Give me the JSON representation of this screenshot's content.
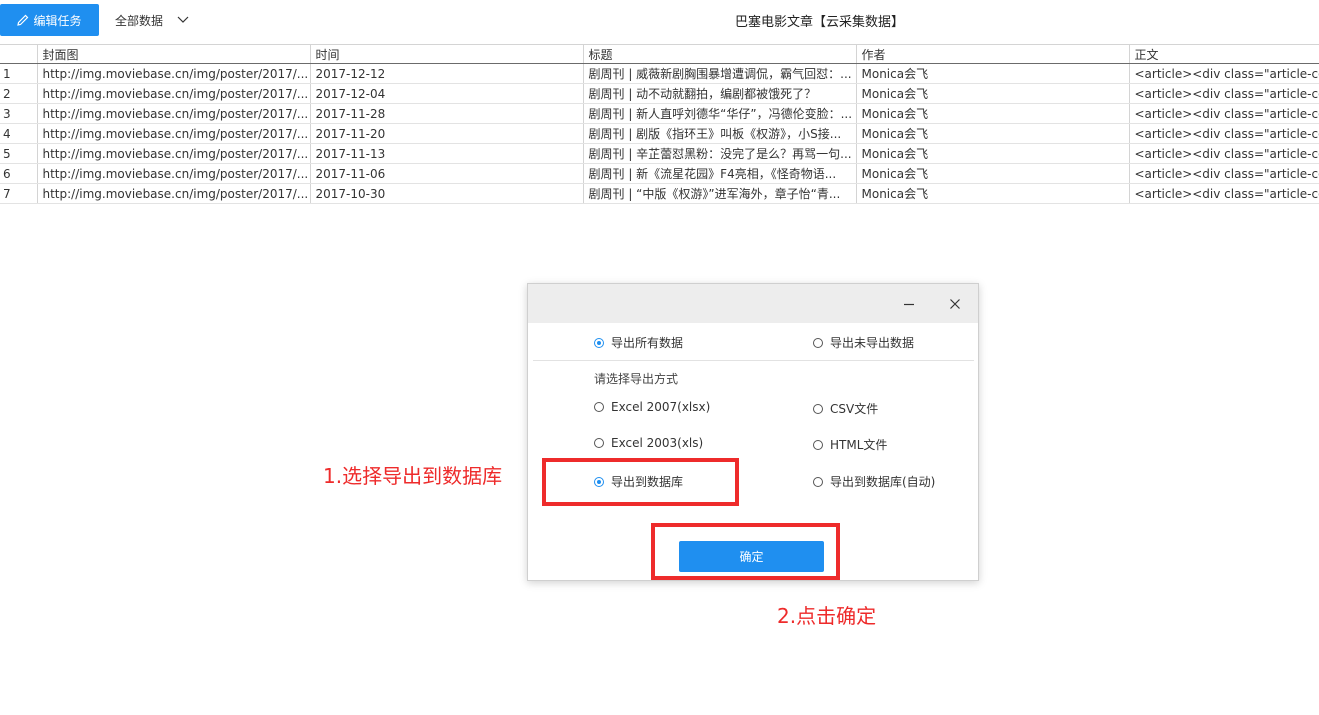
{
  "toolbar": {
    "edit_label": "编辑任务",
    "data_select_label": "全部数据",
    "title": "巴塞电影文章【云采集数据】"
  },
  "table": {
    "columns": [
      "",
      "封面图",
      "时间",
      "标题",
      "作者",
      "正文"
    ],
    "rows": [
      [
        "1",
        "http://img.moviebase.cn/img/poster/2017/...",
        "2017-12-12",
        "剧周刊 | 威薇新剧胸围暴增遭调侃，霸气回怼：...",
        "Monica会飞",
        "<article><div class=\"article-con"
      ],
      [
        "2",
        "http://img.moviebase.cn/img/poster/2017/...",
        "2017-12-04",
        "剧周刊 | 动不动就翻拍，编剧都被饿死了？",
        "Monica会飞",
        "<article><div class=\"article-con"
      ],
      [
        "3",
        "http://img.moviebase.cn/img/poster/2017/...",
        "2017-11-28",
        "剧周刊 | 新人直呼刘德华“华仔”，冯德伦变脸：...",
        "Monica会飞",
        "<article><div class=\"article-con"
      ],
      [
        "4",
        "http://img.moviebase.cn/img/poster/2017/...",
        "2017-11-20",
        "剧周刊 | 剧版《指环王》叫板《权游》，小S接...",
        "Monica会飞",
        "<article><div class=\"article-con"
      ],
      [
        "5",
        "http://img.moviebase.cn/img/poster/2017/...",
        "2017-11-13",
        "剧周刊 | 辛芷蕾怼黑粉：没完了是么？再骂一句...",
        "Monica会飞",
        "<article><div class=\"article-con"
      ],
      [
        "6",
        "http://img.moviebase.cn/img/poster/2017/...",
        "2017-11-06",
        "剧周刊 | 新《流星花园》F4亮相，《怪奇物语...",
        "Monica会飞",
        "<article><div class=\"article-con"
      ],
      [
        "7",
        "http://img.moviebase.cn/img/poster/2017/...",
        "2017-10-30",
        "剧周刊 | “中版《权游》”进军海外，章子怡“青...",
        "Monica会飞",
        "<article><div class=\"article-con"
      ]
    ]
  },
  "dialog": {
    "scope": {
      "all_label": "导出所有数据",
      "unexported_label": "导出未导出数据",
      "selected": "all"
    },
    "method_label": "请选择导出方式",
    "methods": {
      "xlsx": "Excel 2007(xlsx)",
      "csv": "CSV文件",
      "xls": "Excel 2003(xls)",
      "html": "HTML文件",
      "database": "导出到数据库",
      "database_auto": "导出到数据库(自动)",
      "selected": "database"
    },
    "confirm_label": "确定"
  },
  "annotations": {
    "step1": "1.选择导出到数据库",
    "step2": "2.点击确定"
  },
  "colors": {
    "accent": "#1f8ff0",
    "annotation": "#ee2b2b",
    "dialog_header": "#ededed"
  }
}
